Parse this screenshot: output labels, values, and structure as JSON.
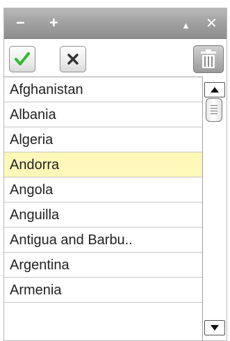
{
  "titlebar": {
    "minimize_icon": "minus-icon",
    "add_icon": "plus-icon",
    "collapse_icon": "triangle-up-icon",
    "close_icon": "close-icon"
  },
  "toolbar": {
    "confirm_icon": "checkmark-icon",
    "cancel_icon": "x-icon",
    "delete_icon": "trash-icon",
    "confirm_color": "#2dbb2d"
  },
  "list": {
    "items": [
      "Afghanistan",
      "Albania",
      "Algeria",
      "Andorra",
      "Angola",
      "Anguilla",
      "Antigua and Barbu..",
      "Argentina",
      "Armenia"
    ],
    "selected_index": 3,
    "selected_color": "#fff8b8"
  },
  "scrollbar": {
    "up_icon": "arrow-up-icon",
    "down_icon": "arrow-down-icon",
    "position": 0.02
  }
}
